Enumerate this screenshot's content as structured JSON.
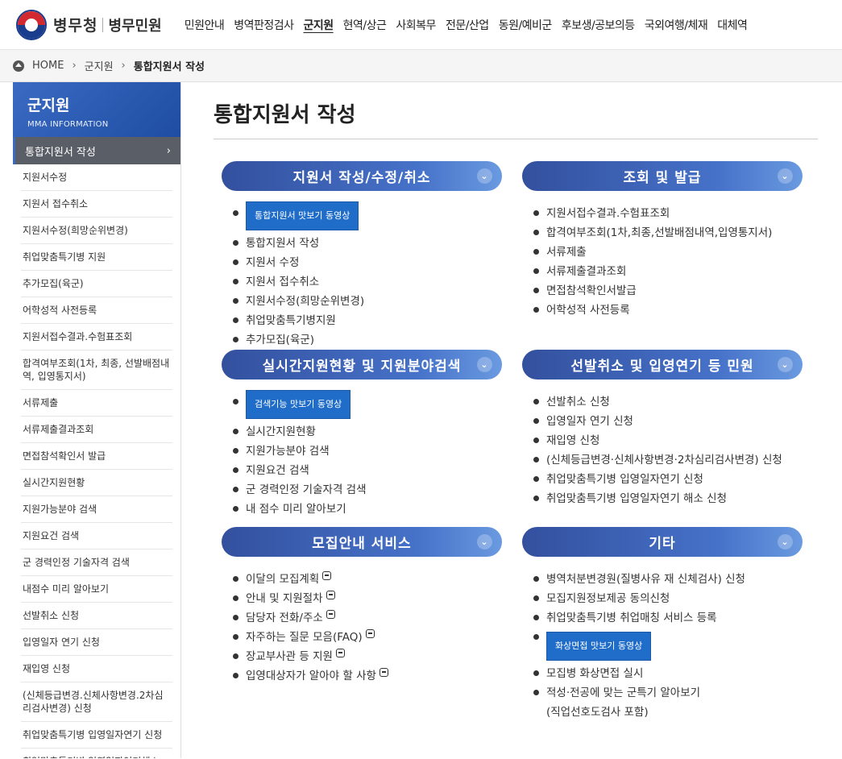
{
  "header": {
    "logo_name": "병무청",
    "logo_sub": "병무민원",
    "nav": [
      "민원안내",
      "병역판정검사",
      "군지원",
      "현역/상근",
      "사회복무",
      "전문/산업",
      "동원/예비군",
      "후보생/공보의등",
      "국외여행/체재",
      "대체역"
    ],
    "nav_active_index": 2
  },
  "breadcrumb": {
    "home": "HOME",
    "level1": "군지원",
    "current": "통합지원서 작성"
  },
  "sidebar": {
    "title": "군지원",
    "subtitle": "MMA INFORMATION",
    "active": "통합지원서 작성",
    "items": [
      "지원서수정",
      "지원서 접수취소",
      "지원서수정(희망순위변경)",
      "취업맞춤특기병 지원",
      "추가모집(육군)",
      "어학성적 사전등록",
      "지원서접수결과.수험표조회",
      "합격여부조회(1차, 최종, 선발배점내역, 입영통지서)",
      "서류제출",
      "서류제출결과조회",
      "면접참석확인서 발급",
      "실시간지원현황",
      "지원가능분야 검색",
      "지원요건 검색",
      "군 경력인정 기술자격 검색",
      "내점수 미리 알아보기",
      "선발취소 신청",
      "입영일자 연기 신청",
      "재입영 신청",
      "(신체등급변경.신체사항변경.2차심리검사변경) 신청",
      "취업맞춤특기병 입영일자연기 신청",
      "취업맞춤특기병 입영일자연기해소 신청"
    ]
  },
  "main": {
    "title": "통합지원서 작성",
    "cards": [
      {
        "title": "지원서 작성/수정/취소",
        "video_label": "통합지원서 맛보기 동영상",
        "items": [
          "통합지원서 작성",
          "지원서 수정",
          "지원서 접수취소",
          "지원서수정(희망순위변경)",
          "취업맞춤특기병지원",
          "추가모집(육군)"
        ]
      },
      {
        "title": "조회 및 발급",
        "items": [
          "지원서접수결과.수험표조회",
          "합격여부조회(1차,최종,선발배점내역,입영통지서)",
          "서류제출",
          "서류제출결과조회",
          "면접참석확인서발급",
          "어학성적 사전등록"
        ]
      },
      {
        "title": "실시간지원현황 및 지원분야검색",
        "video_label": "검색기능 맛보기 동영상",
        "items": [
          "실시간지원현황",
          "지원가능분야 검색",
          "지원요건 검색",
          "군 경력인정 기술자격 검색",
          "내 점수 미리 알아보기"
        ]
      },
      {
        "title": "선발취소 및 입영연기 등 민원",
        "items": [
          "선발취소 신청",
          "입영일자 연기 신청",
          "재입영 신청",
          "(신체등급변경·신체사항변경·2차심리검사변경) 신청",
          "취업맞춤특기병 입영일자연기 신청",
          "취업맞춤특기병 입영일자연기 해소 신청"
        ]
      },
      {
        "title": "모집안내 서비스",
        "items": [
          "이달의 모집계획",
          "안내 및 지원절차",
          "담당자 전화/주소",
          "자주하는 질문 모음(FAQ)",
          "장교부사관 등 지원",
          "입영대상자가 알아야 할 사항"
        ]
      },
      {
        "title": "기타",
        "items_before": [
          "병역처분변경원(질병사유 재 신체검사) 신청",
          "모집지원정보제공 동의신청",
          "취업맞춤특기병 취업매칭 서비스 등록"
        ],
        "video_label": "화상면접 맛보기 동영상",
        "items_after": [
          "모집병 화상면접 실시"
        ],
        "last_item_line1": "적성·전공에 맞는 군특기 알아보기",
        "last_item_line2": "(직업선호도검사 포함)"
      }
    ]
  }
}
